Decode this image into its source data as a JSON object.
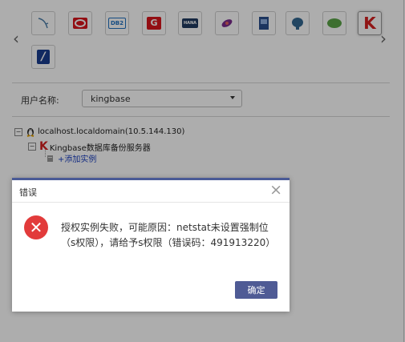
{
  "icons": [
    {
      "name": "mysql-icon",
      "label": "",
      "color": "#4a7ca8"
    },
    {
      "name": "oracle-icon",
      "label": "",
      "color": "#d9161c"
    },
    {
      "name": "db2-icon",
      "label": "DB2",
      "color": "#1f70c1"
    },
    {
      "name": "gbase-icon",
      "label": "G",
      "color": "#d9161c"
    },
    {
      "name": "hana-icon",
      "label": "HANA",
      "color": "#1f3a60"
    },
    {
      "name": "mongodb-icon",
      "label": "",
      "color": "#7a2b8c"
    },
    {
      "name": "document-db-icon",
      "label": "",
      "color": "#2a4e8c"
    },
    {
      "name": "postgresql-icon",
      "label": "",
      "color": "#336791"
    },
    {
      "name": "leaf-db-icon",
      "label": "",
      "color": "#5aa447"
    },
    {
      "name": "kingbase-icon",
      "label": "K",
      "color": "#d42020"
    },
    {
      "name": "slash-db-icon",
      "label": "/",
      "color": "#1a3d8f"
    }
  ],
  "nav": {
    "prev": "‹",
    "next": "›"
  },
  "user": {
    "label": "用户名称:",
    "value": "kingbase"
  },
  "tree": {
    "host": "localhost.localdomain(10.5.144.130)",
    "server": "Kingbase数据库备份服务器",
    "add_instance": "+添加实例",
    "toggle": "−"
  },
  "dialog": {
    "title": "错误",
    "close": "×",
    "icon": "✕",
    "message": "授权实例失败，可能原因：netstat未设置强制位（s权限），请给予s权限（错误码：491913220）",
    "ok": "确定"
  }
}
